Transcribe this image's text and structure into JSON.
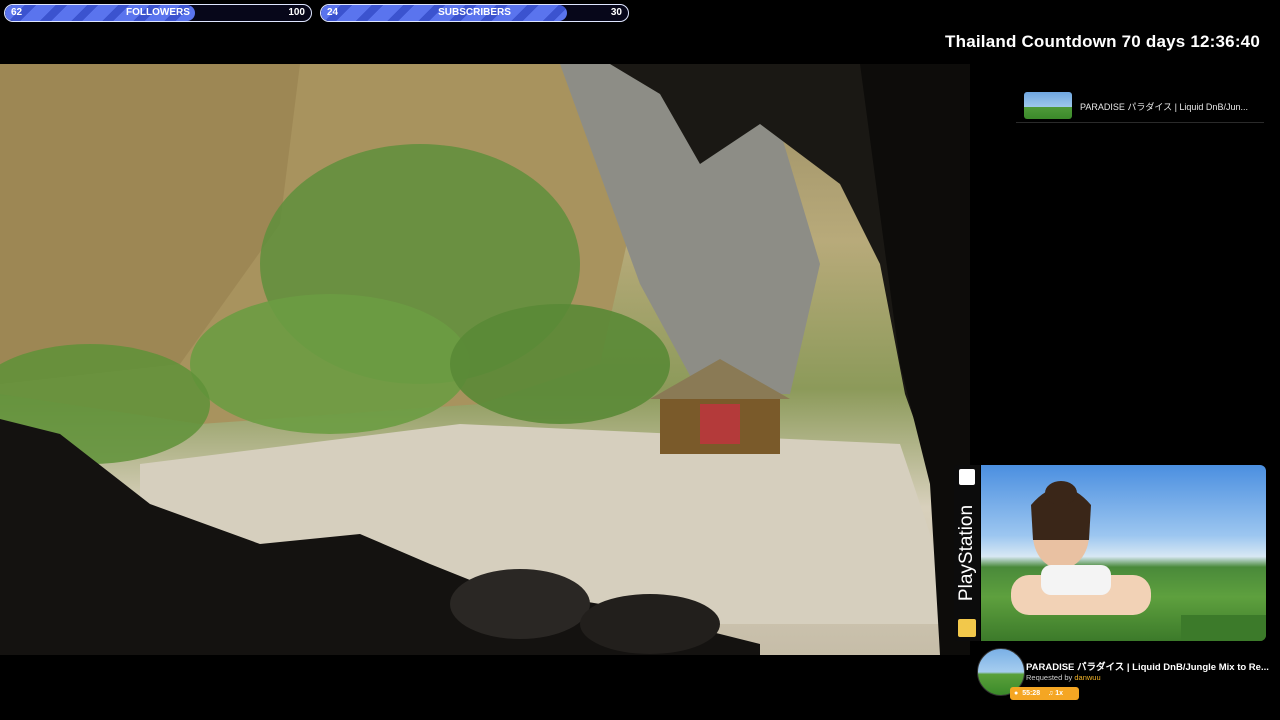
{
  "goals": {
    "followers": {
      "current": "62",
      "label": "FOLLOWERS",
      "target": "100",
      "progress": 0.62
    },
    "subscribers": {
      "current": "24",
      "label": "SUBSCRIBERS",
      "target": "30",
      "progress": 0.8
    }
  },
  "countdown": {
    "text": "Thailand Countdown 70 days 12:36:40"
  },
  "queue": {
    "items": [
      {
        "title": "PARADISE パラダイス | Liquid DnB/Jun..."
      }
    ]
  },
  "sidebar_brand": {
    "text": "PlayStation"
  },
  "now_playing": {
    "title": "PARADISE パラダイス | Liquid DnB/Jungle Mix to Re...",
    "requested_prefix": "Requested by ",
    "requester": "danwuu",
    "time": "55:28",
    "volume": "1x"
  },
  "colors": {
    "goal_fill": "#5a74ee",
    "accent": "#f5a623",
    "background": "#000000"
  },
  "icons": {
    "clock": "clock-icon",
    "music": "music-note-icon"
  }
}
